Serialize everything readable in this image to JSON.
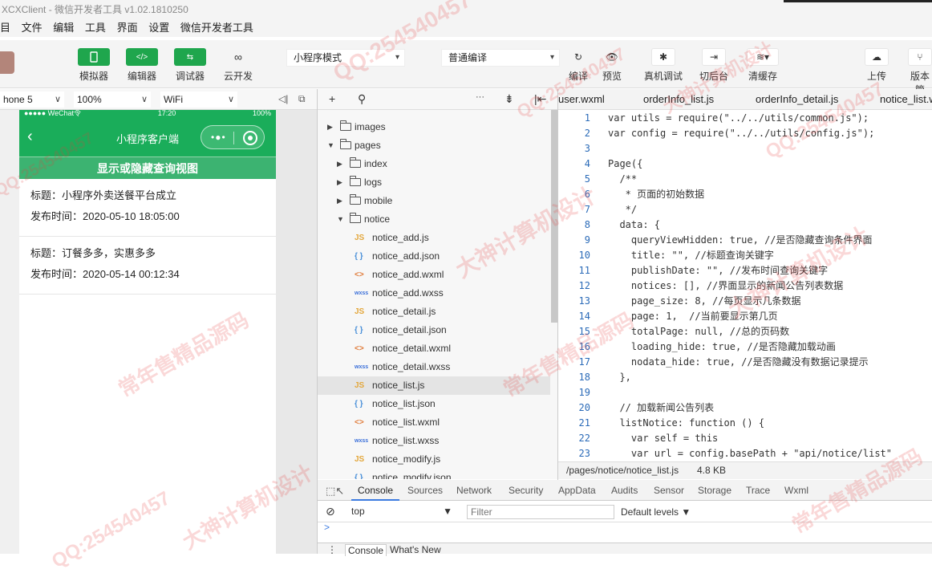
{
  "window": {
    "title": "XCXClient - 微信开发者工具 v1.02.1810250"
  },
  "menu": [
    "目",
    "文件",
    "编辑",
    "工具",
    "界面",
    "设置",
    "微信开发者工具"
  ],
  "toolbar": {
    "simulator": "模拟器",
    "editor": "编辑器",
    "debugger": "调试器",
    "cloud": "云开发",
    "mode_select": "小程序模式",
    "compile_select": "普通编译",
    "compile": "编译",
    "preview": "预览",
    "real_debug": "真机调试",
    "background": "切后台",
    "clear_cache": "清缓存",
    "upload": "上传",
    "version": "版本管"
  },
  "simulator": {
    "device": "hone 5",
    "zoom": "100%",
    "network": "WiFi",
    "status": {
      "carrier": "●●●●● WeChat令",
      "time": "17:20",
      "battery": "100%"
    },
    "nav_title": "小程序客户端",
    "capsule_dots": "•●•",
    "toggle_button": "显示或隐藏查询视图",
    "notices": [
      {
        "title": "标题：小程序外卖送餐平台成立",
        "date": "发布时间：2020-05-10 18:05:00"
      },
      {
        "title": "标题：订餐多多，实惠多多",
        "date": "发布时间：2020-05-14 00:12:34"
      }
    ]
  },
  "filetree": {
    "header_icons": {
      "add": "+",
      "search": "⚲",
      "more": "···",
      "sort": "⇟",
      "collapse": "|⇤"
    },
    "items": [
      {
        "name": "images",
        "type": "folder",
        "open": false,
        "level": 0
      },
      {
        "name": "pages",
        "type": "folder",
        "open": true,
        "level": 0
      },
      {
        "name": "index",
        "type": "folder",
        "open": false,
        "level": 1
      },
      {
        "name": "logs",
        "type": "folder",
        "open": false,
        "level": 1
      },
      {
        "name": "mobile",
        "type": "folder",
        "open": false,
        "level": 1
      },
      {
        "name": "notice",
        "type": "folder",
        "open": true,
        "level": 1
      },
      {
        "name": "notice_add.js",
        "type": "js",
        "icon": "JS"
      },
      {
        "name": "notice_add.json",
        "type": "json",
        "icon": "{ }"
      },
      {
        "name": "notice_add.wxml",
        "type": "wxml",
        "icon": "<>"
      },
      {
        "name": "notice_add.wxss",
        "type": "wxss",
        "icon": "wxss"
      },
      {
        "name": "notice_detail.js",
        "type": "js",
        "icon": "JS"
      },
      {
        "name": "notice_detail.json",
        "type": "json",
        "icon": "{ }"
      },
      {
        "name": "notice_detail.wxml",
        "type": "wxml",
        "icon": "<>"
      },
      {
        "name": "notice_detail.wxss",
        "type": "wxss",
        "icon": "wxss"
      },
      {
        "name": "notice_list.js",
        "type": "js",
        "icon": "JS",
        "selected": true
      },
      {
        "name": "notice_list.json",
        "type": "json",
        "icon": "{ }"
      },
      {
        "name": "notice_list.wxml",
        "type": "wxml",
        "icon": "<>"
      },
      {
        "name": "notice_list.wxss",
        "type": "wxss",
        "icon": "wxss"
      },
      {
        "name": "notice_modify.js",
        "type": "js",
        "icon": "JS"
      },
      {
        "name": "notice_modify.json",
        "type": "json",
        "icon": "{ }"
      }
    ]
  },
  "editor": {
    "tabs": [
      "user.wxml",
      "orderInfo_list.js",
      "orderInfo_detail.js",
      "notice_list.w"
    ],
    "line_numbers": [
      "1",
      "2",
      "3",
      "4",
      "5",
      "6",
      "7",
      "8",
      "9",
      "10",
      "11",
      "12",
      "13",
      "14",
      "15",
      "16",
      "17",
      "18",
      "19",
      "20",
      "21",
      "22",
      "23"
    ],
    "lines": [
      "var utils = require(\"../../utils/common.js\");",
      "var config = require(\"../../utils/config.js\");",
      "",
      "Page({",
      "  /**",
      "   * 页面的初始数据",
      "   */",
      "  data: {",
      "    queryViewHidden: true, //是否隐藏查询条件界面",
      "    title: \"\", //标题查询关键字",
      "    publishDate: \"\", //发布时间查询关键字",
      "    notices: [], //界面显示的新闻公告列表数据",
      "    page_size: 8, //每页显示几条数据",
      "    page: 1,  //当前要显示第几页",
      "    totalPage: null, //总的页码数",
      "    loading_hide: true, //是否隐藏加载动画",
      "    nodata_hide: true, //是否隐藏没有数据记录提示",
      "  },",
      "",
      "  // 加载新闻公告列表",
      "  listNotice: function () {",
      "    var self = this",
      "    var url = config.basePath + \"api/notice/list\""
    ],
    "path": "/pages/notice/notice_list.js",
    "size": "4.8 KB"
  },
  "devtools": {
    "tabs": [
      "Console",
      "Sources",
      "Network",
      "Security",
      "AppData",
      "Audits",
      "Sensor",
      "Storage",
      "Trace",
      "Wxml"
    ],
    "context": "top",
    "filter_placeholder": "Filter",
    "levels": "Default levels ▼",
    "prompt": ">",
    "drawer_tabs": [
      "Console",
      "What's New"
    ]
  },
  "watermarks": [
    "QQ:254540457",
    "常年售精品源码",
    "大神计算机设计",
    "QQ:254540457",
    "常年售精品源码",
    "大神计算机设计",
    "QQ:254540457",
    "QQ:254540457",
    "常年售精品源码",
    "大神计算机设计",
    "QQ:254540457",
    "大神计算机设计"
  ],
  "colors": {
    "accent_green": "#1aad5a",
    "button_green": "#1fa64d",
    "line_number_blue": "#2b6bb8",
    "watermark": "#e63c3c"
  }
}
